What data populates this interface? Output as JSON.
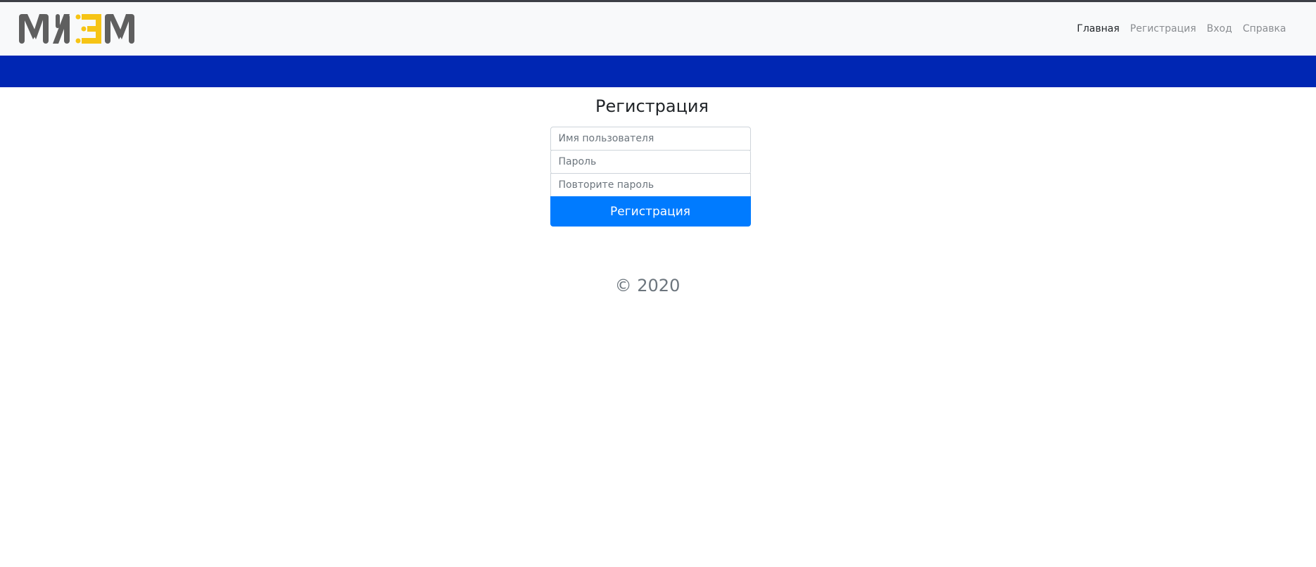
{
  "brand": {
    "logo_text": "МИЭМ",
    "colors": {
      "gray": "#5f5f5f",
      "yellow": "#f6c415"
    }
  },
  "nav": {
    "items": [
      {
        "label": "Главная",
        "active": true
      },
      {
        "label": "Регистрация",
        "active": false
      },
      {
        "label": "Вход",
        "active": false
      },
      {
        "label": "Справка",
        "active": false
      }
    ]
  },
  "form": {
    "title": "Регистрация",
    "username_placeholder": "Имя пользователя",
    "password_placeholder": "Пароль",
    "repeat_password_placeholder": "Повторите пароль",
    "submit_label": "Регистрация"
  },
  "footer": {
    "copyright": "© 2020"
  },
  "colors": {
    "band": "#0026b3",
    "primary": "#007bff",
    "navbar_bg": "#f8f9fa"
  }
}
